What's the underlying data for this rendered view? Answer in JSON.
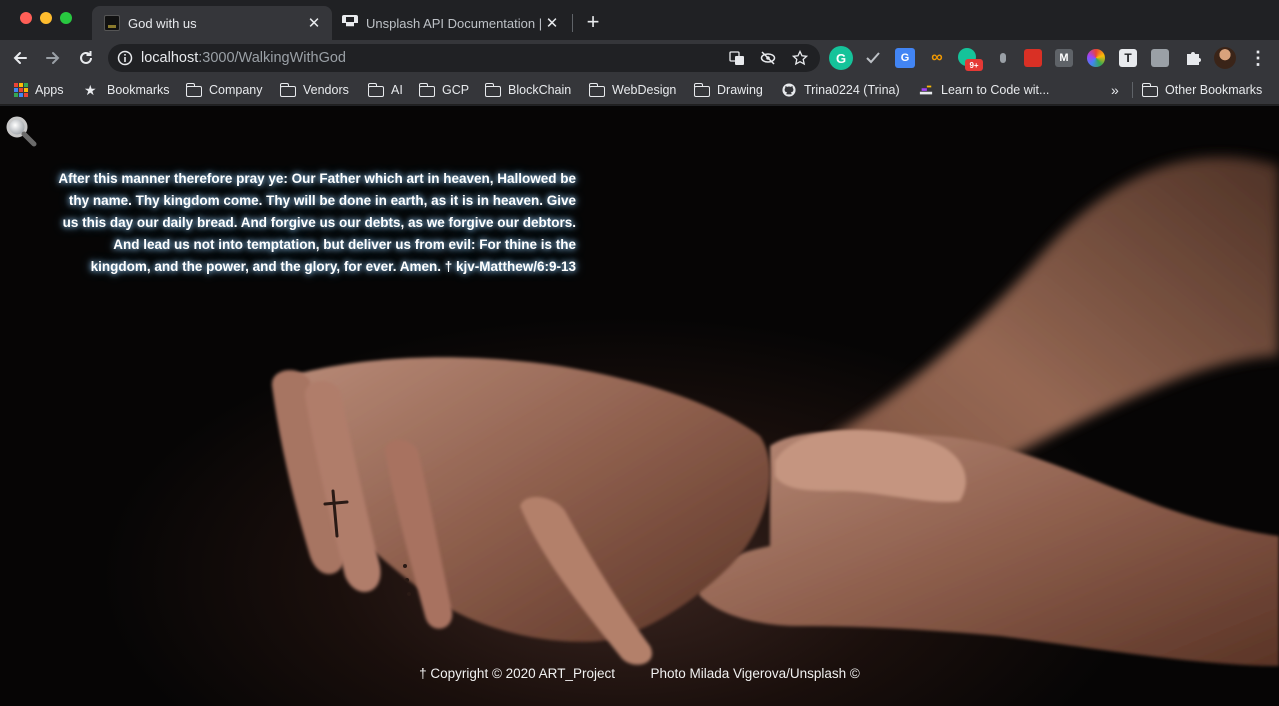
{
  "browser": {
    "tabs": [
      {
        "title": "God with us",
        "active": true
      },
      {
        "title": "Unsplash API Documentation | ",
        "active": false
      }
    ],
    "new_tab_symbol": "+",
    "close_symbol": "✕",
    "address": {
      "host": "localhost",
      "rest": ":3000/WalkingWithGod"
    },
    "extensions": [
      {
        "name": "grammarly-icon",
        "label": "G",
        "color": "#15c39a"
      },
      {
        "name": "check-icon",
        "label": "✓",
        "color": "#35363a"
      },
      {
        "name": "translate-icon",
        "label": "G",
        "color": "#4285f4"
      },
      {
        "name": "infinity-icon",
        "label": "∞",
        "color": "#35363a"
      },
      {
        "name": "grammarly-badge-icon",
        "label": "9+",
        "color": "#e53935"
      },
      {
        "name": "mic-icon",
        "label": "",
        "color": "#35363a"
      },
      {
        "name": "red-extension-icon",
        "label": "",
        "color": "#d93025"
      },
      {
        "name": "m-extension-icon",
        "label": "M",
        "color": "#5f6368"
      },
      {
        "name": "color-wheel-icon",
        "label": "",
        "color": "#35363a"
      },
      {
        "name": "t-extension-icon",
        "label": "T",
        "color": "#e8eaed"
      },
      {
        "name": "box-extension-icon",
        "label": "",
        "color": "#9aa0a6"
      },
      {
        "name": "puzzle-icon",
        "label": "",
        "color": "#35363a"
      },
      {
        "name": "profile-avatar",
        "label": "",
        "color": "#5c4033"
      },
      {
        "name": "menu-dots-icon",
        "label": "⋮",
        "color": "#35363a"
      }
    ],
    "badge": "9+"
  },
  "bookmarks": {
    "items": [
      {
        "label": "Apps",
        "icon": "apps-grid-icon"
      },
      {
        "label": "Bookmarks",
        "icon": "star-icon"
      },
      {
        "label": "Company",
        "icon": "folder-icon"
      },
      {
        "label": "Vendors",
        "icon": "folder-icon"
      },
      {
        "label": "AI",
        "icon": "folder-icon"
      },
      {
        "label": "GCP",
        "icon": "folder-icon"
      },
      {
        "label": "BlockChain",
        "icon": "folder-icon"
      },
      {
        "label": "WebDesign",
        "icon": "folder-icon"
      },
      {
        "label": "Drawing",
        "icon": "folder-icon"
      },
      {
        "label": "Trina0224 (Trina)",
        "icon": "github-icon"
      },
      {
        "label": "Learn to Code wit...",
        "icon": "code-icon"
      }
    ],
    "overflow": "»",
    "other": "Other Bookmarks"
  },
  "page": {
    "verse": "After this manner therefore pray ye: Our Father which art in heaven, Hallowed be thy name. Thy kingdom come. Thy will be done in earth, as it is in heaven. Give us this day our daily bread. And forgive us our debts, as we forgive our debtors. And lead us not into temptation, but deliver us from evil: For thine is the kingdom, and the power, and the glory, for ever. Amen. † kjv-Matthew/6:9-13",
    "copyright": "† Copyright © 2020 ART_Project",
    "photo_credit": "Photo Milada Vigerova/Unsplash ©"
  }
}
